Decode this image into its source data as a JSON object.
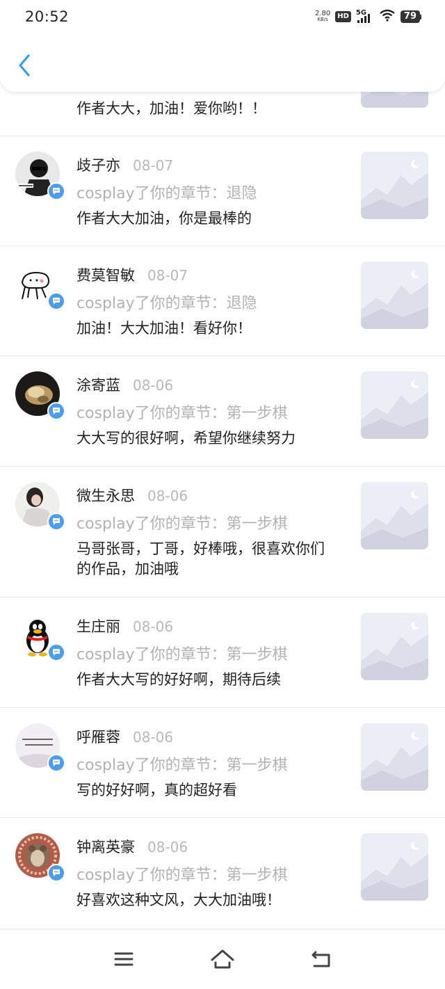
{
  "status": {
    "time": "20:52",
    "net_speed": "2.80",
    "net_unit": "KB/s",
    "hd": "HD",
    "network": "5G",
    "battery": "79"
  },
  "items": [
    {
      "name": "",
      "date": "",
      "action": "",
      "comment": "作者大大，加油！爱你哟！！"
    },
    {
      "name": "歧子亦",
      "date": "08-07",
      "action": "cosplay了你的章节：退隐",
      "comment": "作者大大加油，你是最棒的"
    },
    {
      "name": "费莫智敏",
      "date": "08-07",
      "action": "cosplay了你的章节：退隐",
      "comment": "加油！大大加油！看好你！"
    },
    {
      "name": "涂寄蓝",
      "date": "08-06",
      "action": "cosplay了你的章节：第一步棋",
      "comment": "大大写的很好啊，希望你继续努力"
    },
    {
      "name": "微生永思",
      "date": "08-06",
      "action": "cosplay了你的章节：第一步棋",
      "comment": "马哥张哥，丁哥，好棒哦，很喜欢你们的作品，加油哦"
    },
    {
      "name": "生庄丽",
      "date": "08-06",
      "action": "cosplay了你的章节：第一步棋",
      "comment": "作者大大写的好好啊，期待后续"
    },
    {
      "name": "呼雁蓉",
      "date": "08-06",
      "action": "cosplay了你的章节：第一步棋",
      "comment": "写的好好啊，真的超好看"
    },
    {
      "name": "钟离英豪",
      "date": "08-06",
      "action": "cosplay了你的章节：第一步棋",
      "comment": "好喜欢这种文风，大大加油哦！"
    }
  ],
  "colors": {
    "accent": "#4d9ee8",
    "muted_text": "#b2b2b2",
    "date_text": "#b8b8b8"
  },
  "icons": {
    "back": "chevron-left-icon",
    "badge": "chat-bubble-icon",
    "menu": "menu-icon",
    "home": "home-icon",
    "return": "return-icon"
  }
}
